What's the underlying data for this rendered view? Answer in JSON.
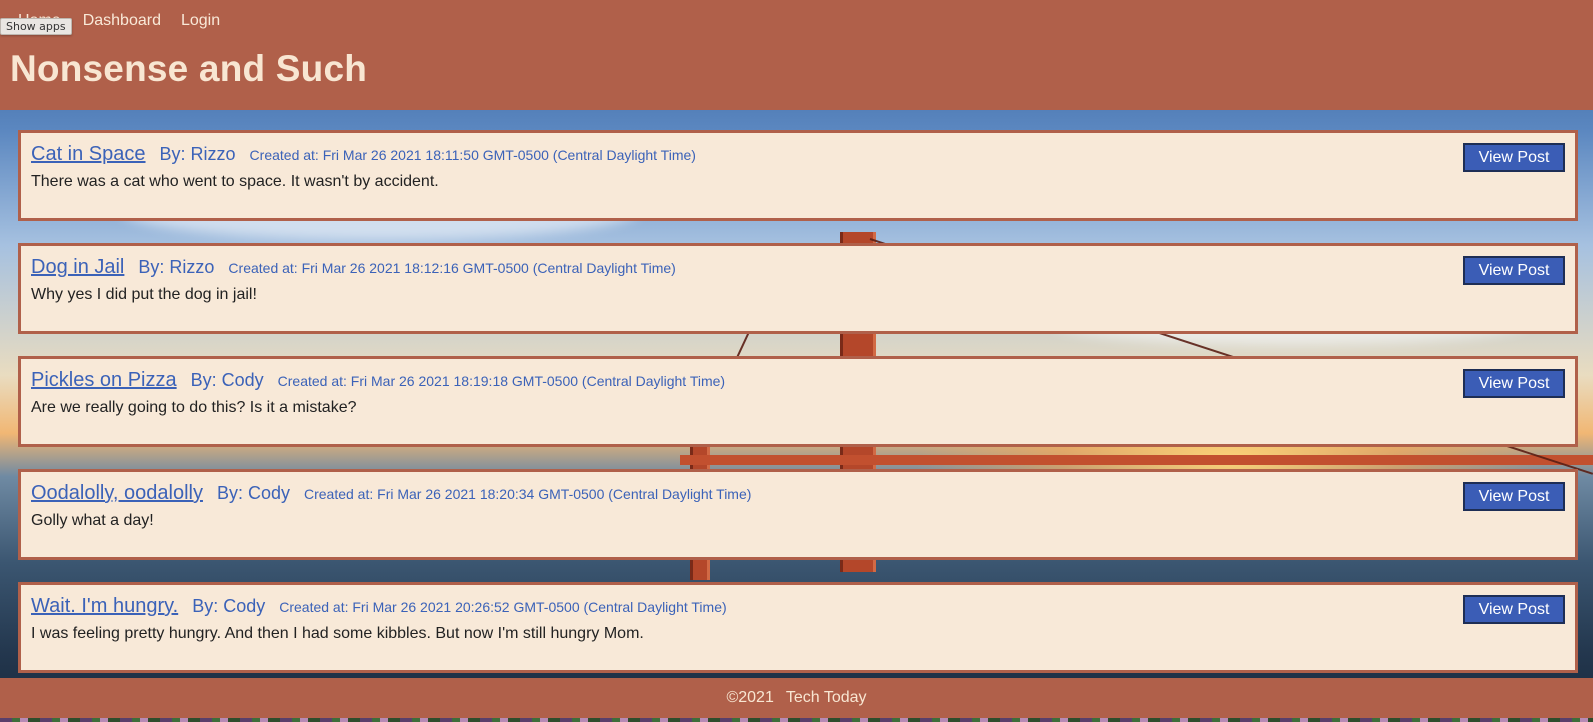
{
  "nav": {
    "home_label": "Home",
    "dashboard_label": "Dashboard",
    "login_label": "Login"
  },
  "tooltip": {
    "show_apps": "Show apps"
  },
  "site": {
    "title": "Nonsense and Such"
  },
  "posts": [
    {
      "title": "Cat in Space",
      "author": "By: Rizzo",
      "created": "Created at: Fri Mar 26 2021 18:11:50 GMT-0500 (Central Daylight Time)",
      "body": "There was a cat who went to space. It wasn't by accident.",
      "button": "View Post"
    },
    {
      "title": "Dog in Jail",
      "author": "By: Rizzo",
      "created": "Created at: Fri Mar 26 2021 18:12:16 GMT-0500 (Central Daylight Time)",
      "body": "Why yes I did put the dog in jail!",
      "button": "View Post"
    },
    {
      "title": "Pickles on Pizza",
      "author": "By: Cody",
      "created": "Created at: Fri Mar 26 2021 18:19:18 GMT-0500 (Central Daylight Time)",
      "body": "Are we really going to do this? Is it a mistake?",
      "button": "View Post"
    },
    {
      "title": "Oodalolly, oodalolly",
      "author": "By: Cody",
      "created": "Created at: Fri Mar 26 2021 18:20:34 GMT-0500 (Central Daylight Time)",
      "body": "Golly what a day!",
      "button": "View Post"
    },
    {
      "title": "Wait. I'm hungry.",
      "author": "By: Cody",
      "created": "Created at: Fri Mar 26 2021 20:26:52 GMT-0500 (Central Daylight Time)",
      "body": "I was feeling pretty hungry. And then I had some kibbles. But now I'm still hungry Mom.",
      "button": "View Post"
    }
  ],
  "footer": {
    "copyright": "©2021",
    "brand": "Tech Today"
  },
  "colors": {
    "header_bg": "#b0604a",
    "card_bg": "#f8e9d8",
    "link_blue": "#3b62b8",
    "button_bg": "#3b5db6"
  }
}
